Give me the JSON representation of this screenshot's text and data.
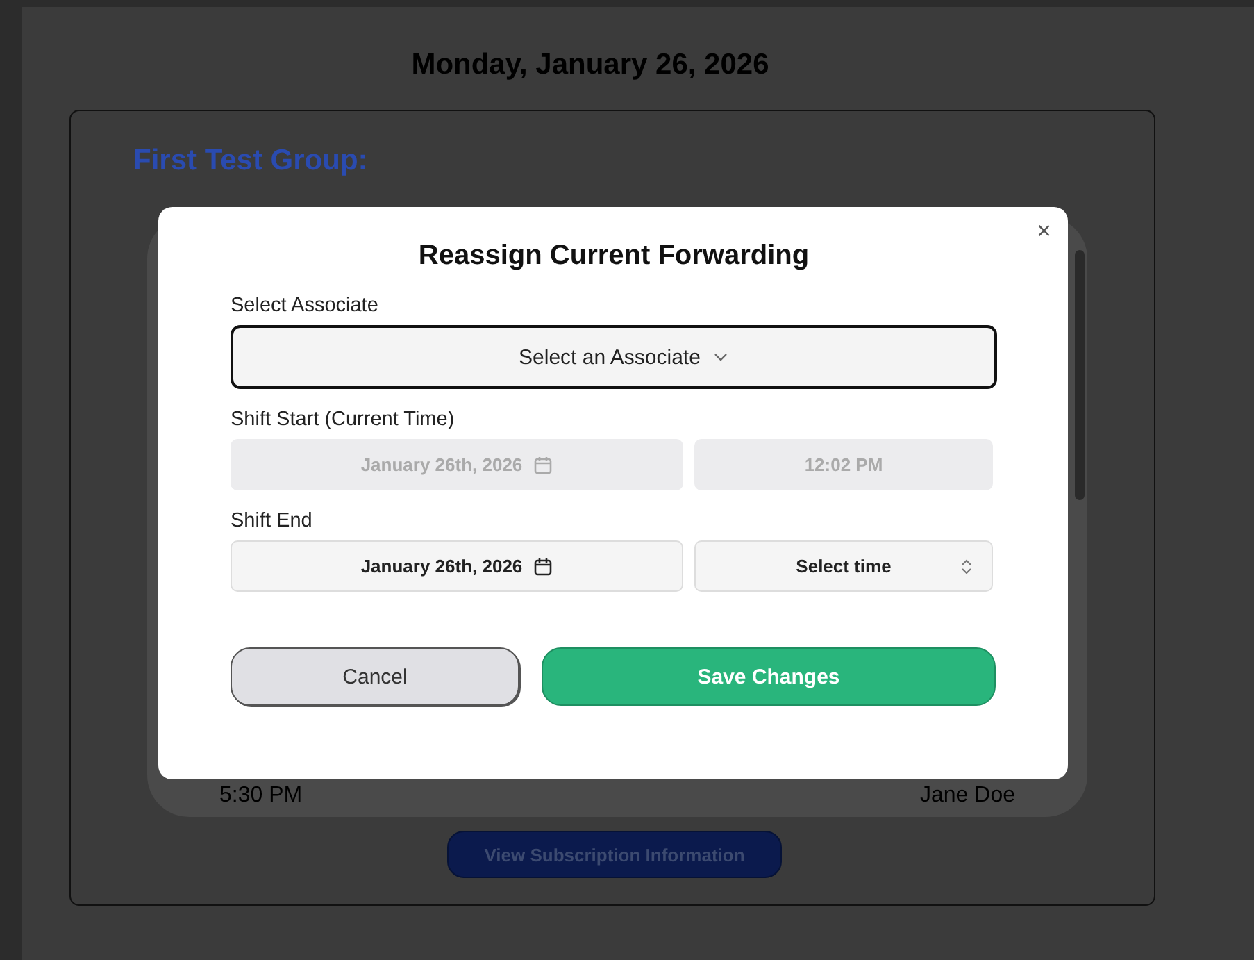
{
  "page": {
    "date_heading": "Monday, January 26, 2026"
  },
  "group": {
    "title": "First Test Group:",
    "rows": [
      {
        "time": "5:30 PM",
        "name": "Jane Doe"
      }
    ],
    "subscription_button": "View Subscription Information"
  },
  "dialog": {
    "title": "Reassign Current Forwarding",
    "close": "×",
    "associate": {
      "label": "Select Associate",
      "placeholder": "Select an Associate"
    },
    "shifts": [
      {
        "label": "Shift Start (Current Time)",
        "date": "January 26th, 2026",
        "time": "12:02 PM",
        "kind": "fixed",
        "disabled": true
      },
      {
        "label": "Shift End",
        "date": "January 26th, 2026",
        "time": "Select time",
        "kind": "picker",
        "disabled": false
      }
    ],
    "buttons": [
      {
        "label": "Cancel",
        "kind": "cancel"
      },
      {
        "label": "Save Changes",
        "kind": "primary"
      }
    ]
  }
}
